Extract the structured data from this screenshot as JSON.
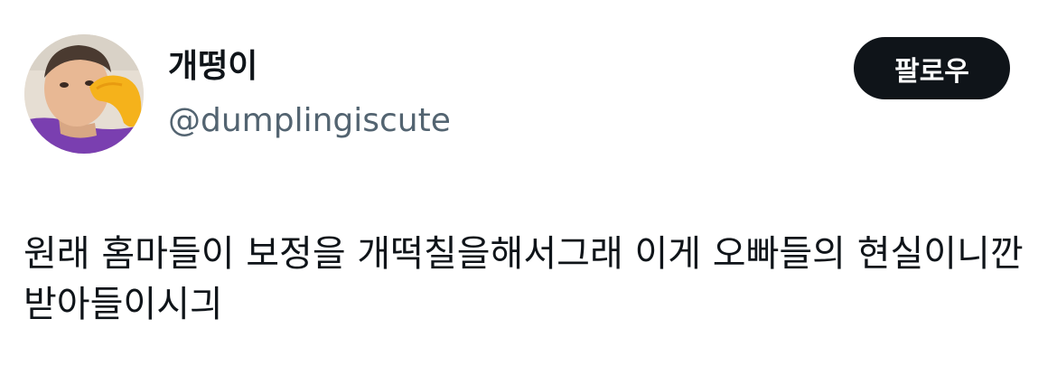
{
  "author": {
    "display_name": "개떵이",
    "handle": "@dumplingiscute",
    "avatar_icon": "user-avatar-photo"
  },
  "follow_button": {
    "label": "팔로우"
  },
  "tweet": {
    "text": "원래 홈마들이 보정을 개떡칠을해서그래 이게 오빠들의 현실이니깐 받아들이시긔"
  },
  "colors": {
    "text_primary": "#0f1419",
    "text_secondary": "#536471",
    "button_bg": "#0f1419",
    "button_text": "#ffffff",
    "background": "#ffffff"
  }
}
